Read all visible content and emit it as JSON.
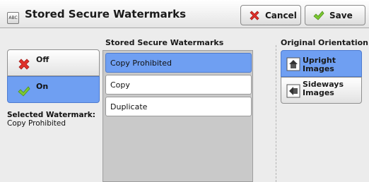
{
  "header": {
    "icon_text": "ABC",
    "title": "Stored Secure Watermarks",
    "cancel_label": "Cancel",
    "save_label": "Save"
  },
  "state_toggle": {
    "off_label": "Off",
    "on_label": "On",
    "selected": "On"
  },
  "selected_watermark": {
    "label": "Selected Watermark:",
    "value": "Copy Prohibited"
  },
  "watermark_list": {
    "header": "Stored Secure Watermarks",
    "items": [
      {
        "label": "Copy Prohibited",
        "selected": true
      },
      {
        "label": "Copy",
        "selected": false
      },
      {
        "label": "Duplicate",
        "selected": false
      }
    ]
  },
  "orientation": {
    "header": "Original Orientation",
    "upright_label": "Upright Images",
    "sideways_label": "Sideways Images",
    "selected": "Upright Images"
  },
  "colors": {
    "selection_blue": "#6f9ff2",
    "cancel_red": "#e0302a",
    "check_green": "#7cc832"
  }
}
